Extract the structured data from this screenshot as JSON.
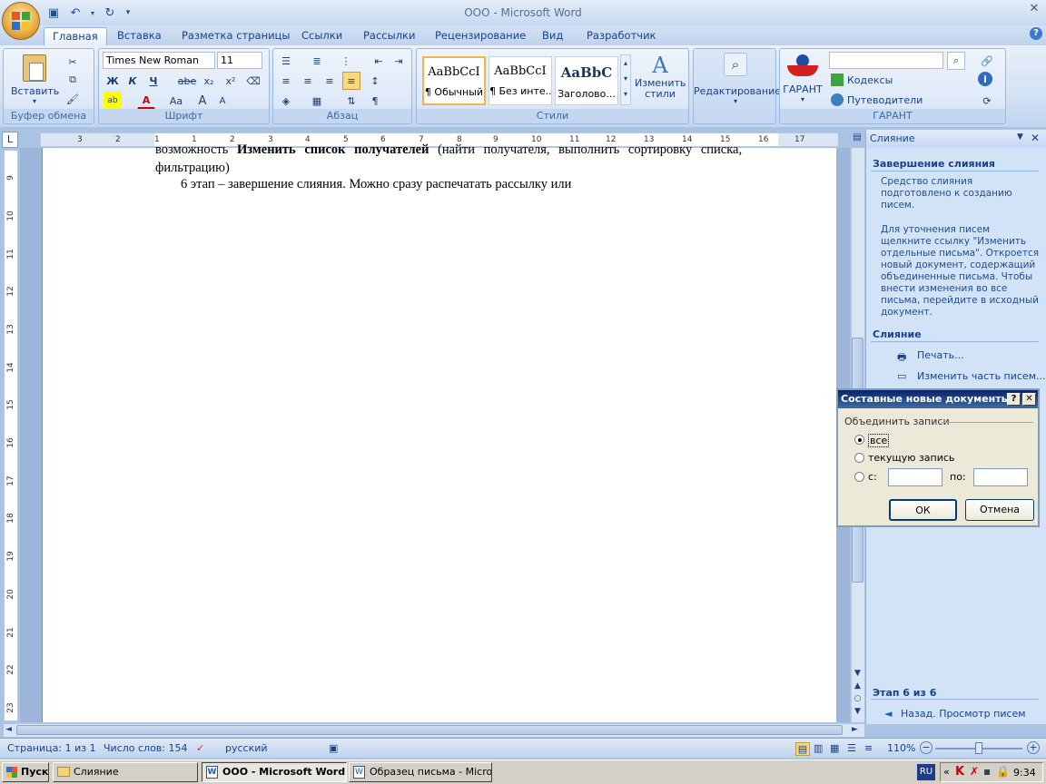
{
  "window": {
    "title": "OOO - Microsoft Word"
  },
  "tabs": [
    "Главная",
    "Вставка",
    "Разметка страницы",
    "Ссылки",
    "Рассылки",
    "Рецензирование",
    "Вид",
    "Разработчик"
  ],
  "ribbon": {
    "clipboard": {
      "paste_label": "Вставить",
      "group_label": "Буфер обмена"
    },
    "font": {
      "name": "Times New Roman",
      "size": "11",
      "group_label": "Шрифт",
      "bold": "Ж",
      "italic": "К",
      "underline": "Ч",
      "strike": "abe",
      "sub": "x₂",
      "sup": "x²",
      "case": "Aa",
      "grow": "A",
      "shrink": "A"
    },
    "paragraph": {
      "group_label": "Абзац"
    },
    "styles": {
      "group_label": "Стили",
      "tiles": [
        {
          "preview": "AaBbCcI",
          "name": "¶ Обычный"
        },
        {
          "preview": "AaBbCcI",
          "name": "¶ Без инте..."
        },
        {
          "preview": "AaBbC",
          "name": "Заголово..."
        }
      ],
      "change_label": "Изменить стили"
    },
    "editing": {
      "label": "Редактирование"
    },
    "garant": {
      "label": "ГАРАНТ",
      "codex": "Кодексы",
      "guides": "Путеводители",
      "group_label": "ГАРАНТ",
      "search_value": ""
    }
  },
  "ruler": {
    "h_ticks": [
      "3",
      "2",
      "1",
      "1",
      "2",
      "3",
      "4",
      "5",
      "6",
      "7",
      "8",
      "9",
      "10",
      "11",
      "12",
      "13",
      "14",
      "15",
      "16",
      "17"
    ],
    "v_ticks": [
      "9",
      "10",
      "11",
      "12",
      "13",
      "14",
      "15",
      "16",
      "17",
      "18",
      "19",
      "20",
      "21",
      "22",
      "23"
    ]
  },
  "document": {
    "line1_pre": "возможность ",
    "line1_bold": "Изменить список получателей",
    "line1_post": " (найти получателя, выполнить сортировку списка,",
    "line2": "фильтрацию)",
    "line3": "6 этап – завершение слияния. Можно сразу распечатать рассылку или"
  },
  "task_pane": {
    "title": "Слияние",
    "section1": "Завершение слияния",
    "text1": "Средство слияния подготовлено к созданию писем.",
    "text2": "Для уточнения писем щелкните ссылку \"Изменить отдельные письма\". Откроется новый документ, содержащий объединенные письма. Чтобы внести изменения во все письма, перейдите в исходный документ.",
    "section2": "Слияние",
    "print_link": "Печать...",
    "edit_link": "Изменить часть писем...",
    "step": "Этап 6 из 6",
    "back_link": "Назад. Просмотр писем"
  },
  "dialog": {
    "title": "Составные новые документы",
    "group": "Объединить записи",
    "opt_all": "все",
    "opt_current": "текущую запись",
    "opt_from": "с:",
    "to_label": "по:",
    "from_value": "",
    "to_value": "",
    "ok": "ОК",
    "cancel": "Отмена"
  },
  "status": {
    "page": "Страница: 1 из 1",
    "words": "Число слов: 154",
    "lang": "русский",
    "zoom": "110%"
  },
  "taskbar": {
    "start": "Пуск",
    "items": [
      "Слияние",
      "OOO - Microsoft Word",
      "Образец письма - Micro..."
    ],
    "lang": "RU",
    "time": "9:34"
  }
}
